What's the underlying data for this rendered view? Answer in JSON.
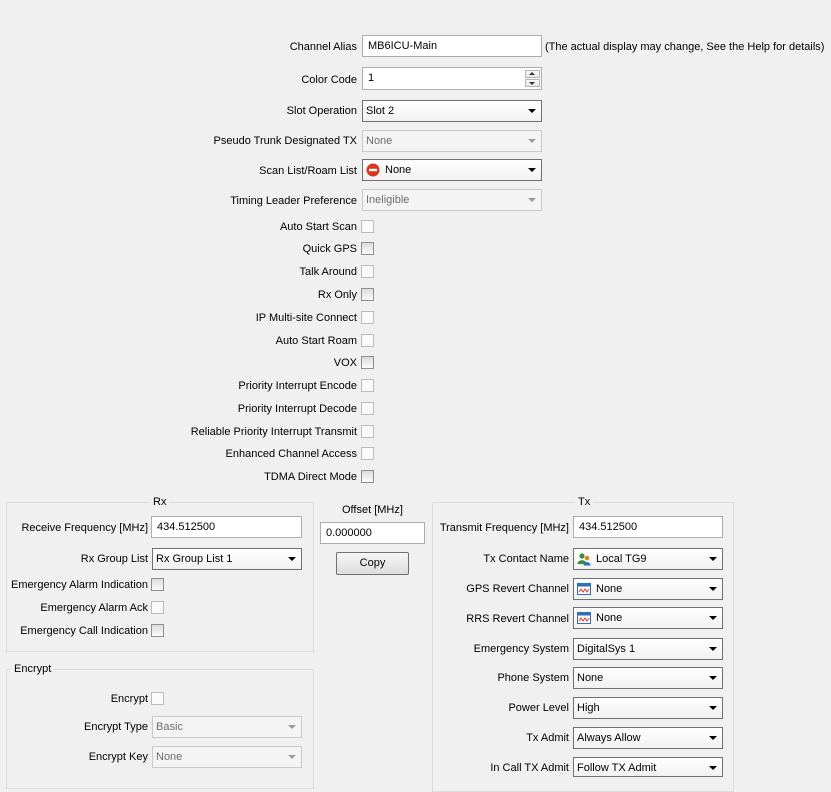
{
  "top": {
    "channel_alias": {
      "label": "Channel Alias",
      "value": "MB6ICU-Main",
      "note": "(The actual display may change, See the Help for details)"
    },
    "color_code": {
      "label": "Color Code",
      "value": "1"
    },
    "slot_operation": {
      "label": "Slot Operation",
      "value": "Slot 2"
    },
    "pseudo_trunk": {
      "label": "Pseudo Trunk Designated TX",
      "value": "None"
    },
    "scan_list": {
      "label": "Scan List/Roam List",
      "value": "None"
    },
    "timing_leader": {
      "label": "Timing Leader Preference",
      "value": "Ineligible"
    }
  },
  "checkboxes": [
    {
      "label": "Auto Start Scan",
      "checked": false
    },
    {
      "label": "Quick GPS",
      "checked": false
    },
    {
      "label": "Talk Around",
      "checked": false
    },
    {
      "label": "Rx Only",
      "checked": false
    },
    {
      "label": "IP Multi-site Connect",
      "checked": false
    },
    {
      "label": "Auto Start Roam",
      "checked": false
    },
    {
      "label": "VOX",
      "checked": false
    },
    {
      "label": "Priority Interrupt Encode",
      "checked": false
    },
    {
      "label": "Priority Interrupt Decode",
      "checked": false
    },
    {
      "label": "Reliable Priority Interrupt Transmit",
      "checked": false
    },
    {
      "label": "Enhanced Channel Access",
      "checked": false
    },
    {
      "label": "TDMA Direct Mode",
      "checked": false
    }
  ],
  "rx": {
    "title": "Rx",
    "freq_label": "Receive Frequency [MHz]",
    "freq_value": "434.512500",
    "group_label": "Rx Group List",
    "group_value": "Rx Group List 1",
    "emerg_alarm": "Emergency Alarm Indication",
    "emerg_ack": "Emergency Alarm Ack",
    "emerg_call": "Emergency Call Indication"
  },
  "offset": {
    "label": "Offset [MHz]",
    "value": "0.000000",
    "copy": "Copy"
  },
  "tx": {
    "title": "Tx",
    "freq_label": "Transmit Frequency [MHz]",
    "freq_value": "434.512500",
    "contact_label": "Tx Contact Name",
    "contact_value": "Local TG9",
    "gps_label": "GPS Revert Channel",
    "gps_value": "None",
    "rrs_label": "RRS Revert Channel",
    "rrs_value": "None",
    "emerg_sys_label": "Emergency System",
    "emerg_sys_value": "DigitalSys 1",
    "phone_label": "Phone System",
    "phone_value": "None",
    "power_label": "Power Level",
    "power_value": "High",
    "admit_label": "Tx Admit",
    "admit_value": "Always Allow",
    "incall_label": "In Call TX Admit",
    "incall_value": "Follow TX Admit"
  },
  "encrypt": {
    "title": "Encrypt",
    "encrypt_label": "Encrypt",
    "type_label": "Encrypt Type",
    "type_value": "Basic",
    "key_label": "Encrypt Key",
    "key_value": "None"
  },
  "icons": {
    "scan": "no-entry-icon",
    "contact": "group-contact-icon",
    "channel": "channel-icon"
  },
  "colors": {
    "no_entry": "#d9381e",
    "channel_icon": "#2f6fb6"
  }
}
